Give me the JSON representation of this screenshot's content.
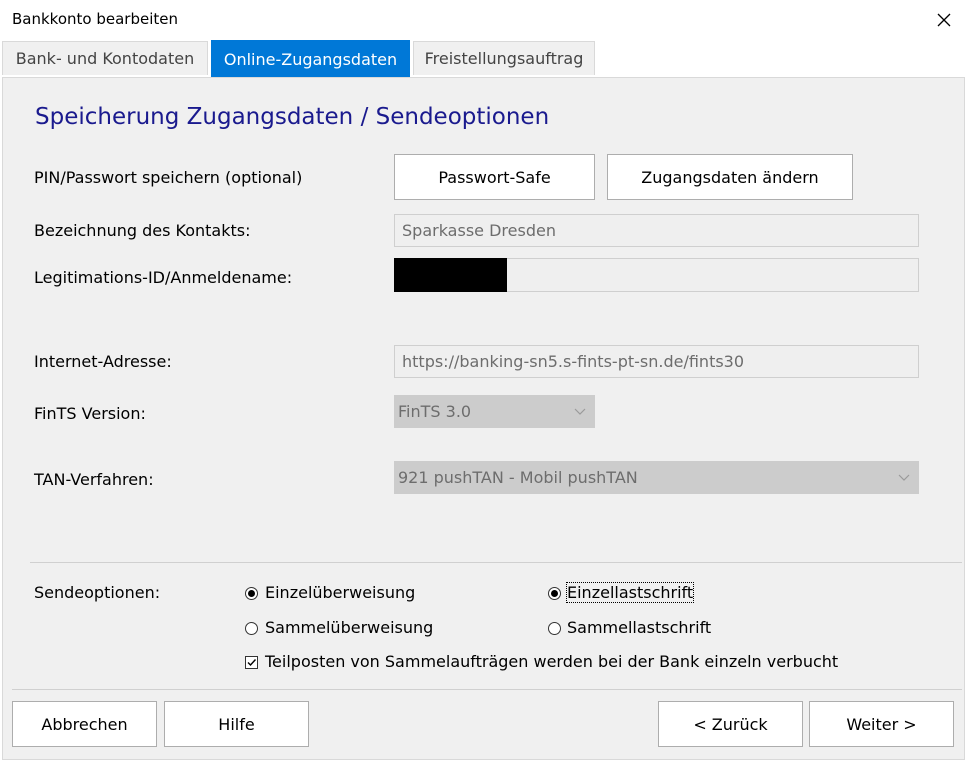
{
  "window": {
    "title": "Bankkonto bearbeiten"
  },
  "tabs": [
    {
      "label": "Bank- und Kontodaten",
      "active": false
    },
    {
      "label": "Online-Zugangsdaten",
      "active": true
    },
    {
      "label": "Freistellungsauftrag",
      "active": false
    }
  ],
  "section": {
    "heading": "Speicherung Zugangsdaten / Sendeoptionen"
  },
  "pin": {
    "label": "PIN/Passwort speichern (optional)",
    "safe_button": "Passwort-Safe",
    "change_button": "Zugangsdaten ändern"
  },
  "contact": {
    "label": "Bezeichnung des Kontakts:",
    "value": "Sparkasse Dresden"
  },
  "login": {
    "label": "Legitimations-ID/Anmeldename:",
    "value": ""
  },
  "internet": {
    "label": "Internet-Adresse:",
    "value": "https://banking-sn5.s-fints-pt-sn.de/fints30"
  },
  "fints": {
    "label": "FinTS Version:",
    "selected": "FinTS 3.0"
  },
  "tan": {
    "label": "TAN-Verfahren:",
    "selected": "921 pushTAN - Mobil pushTAN"
  },
  "send": {
    "label": "Sendeoptionen:",
    "options": [
      {
        "label": "Einzelüberweisung",
        "checked": true
      },
      {
        "label": "Einzellastschrift",
        "checked": true
      },
      {
        "label": "Sammelüberweisung",
        "checked": false
      },
      {
        "label": "Sammellastschrift",
        "checked": false
      }
    ],
    "teilposten": {
      "label": "Teilposten von Sammelaufträgen werden bei der Bank einzeln verbucht",
      "checked": true
    }
  },
  "footer": {
    "cancel": "Abbrechen",
    "help": "Hilfe",
    "back": "< Zurück",
    "next": "Weiter >"
  },
  "colors": {
    "accent": "#0078d7",
    "heading": "#1a1a8e",
    "panel": "#f0f0f0"
  }
}
